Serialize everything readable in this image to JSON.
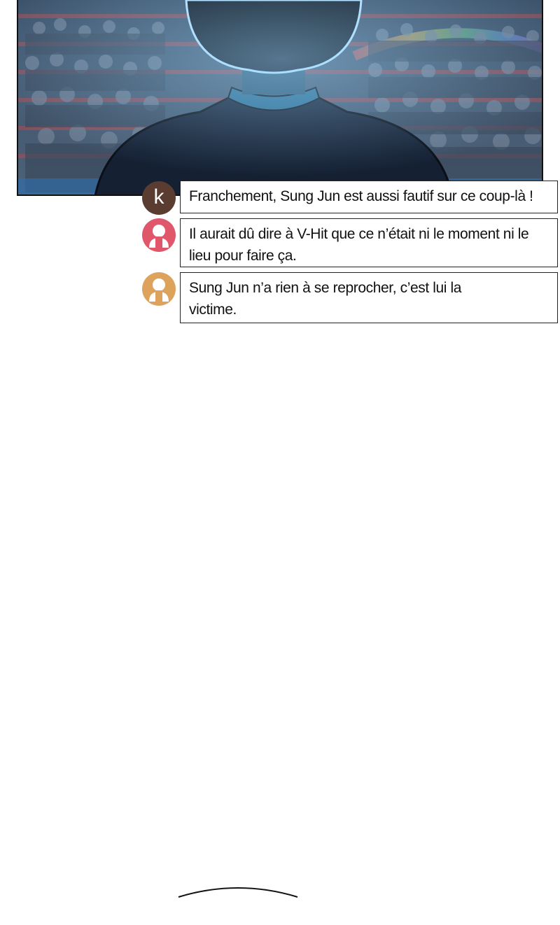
{
  "comments": [
    {
      "avatar": {
        "type": "letter",
        "letter": "k",
        "color": "#5a3d30",
        "icon": "letter-avatar"
      },
      "text": "Franchement, Sung Jun est aussi fautif sur ce coup-là !"
    },
    {
      "avatar": {
        "type": "person",
        "color": "#e0566a",
        "icon": "person-icon"
      },
      "text": "Il aurait dû dire à V-Hit que ce n’était ni le moment ni le lieu pour faire ça."
    },
    {
      "avatar": {
        "type": "person",
        "color": "#dda35d",
        "icon": "person-icon"
      },
      "text": "Sung Jun n’a rien à se reprocher, c’est lui la victime."
    }
  ]
}
